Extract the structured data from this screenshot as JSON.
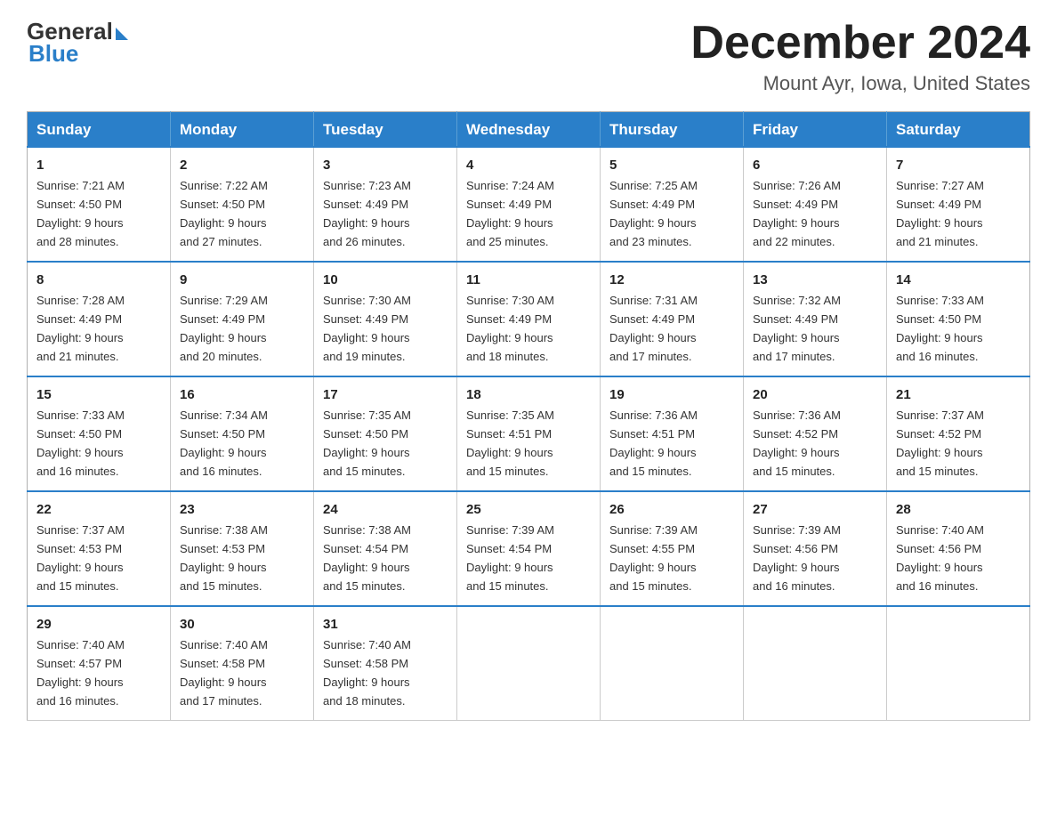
{
  "header": {
    "logo": {
      "general": "General",
      "blue": "Blue"
    },
    "title": "December 2024",
    "subtitle": "Mount Ayr, Iowa, United States"
  },
  "calendar": {
    "headers": [
      "Sunday",
      "Monday",
      "Tuesday",
      "Wednesday",
      "Thursday",
      "Friday",
      "Saturday"
    ],
    "weeks": [
      [
        {
          "day": "1",
          "info": "Sunrise: 7:21 AM\nSunset: 4:50 PM\nDaylight: 9 hours\nand 28 minutes."
        },
        {
          "day": "2",
          "info": "Sunrise: 7:22 AM\nSunset: 4:50 PM\nDaylight: 9 hours\nand 27 minutes."
        },
        {
          "day": "3",
          "info": "Sunrise: 7:23 AM\nSunset: 4:49 PM\nDaylight: 9 hours\nand 26 minutes."
        },
        {
          "day": "4",
          "info": "Sunrise: 7:24 AM\nSunset: 4:49 PM\nDaylight: 9 hours\nand 25 minutes."
        },
        {
          "day": "5",
          "info": "Sunrise: 7:25 AM\nSunset: 4:49 PM\nDaylight: 9 hours\nand 23 minutes."
        },
        {
          "day": "6",
          "info": "Sunrise: 7:26 AM\nSunset: 4:49 PM\nDaylight: 9 hours\nand 22 minutes."
        },
        {
          "day": "7",
          "info": "Sunrise: 7:27 AM\nSunset: 4:49 PM\nDaylight: 9 hours\nand 21 minutes."
        }
      ],
      [
        {
          "day": "8",
          "info": "Sunrise: 7:28 AM\nSunset: 4:49 PM\nDaylight: 9 hours\nand 21 minutes."
        },
        {
          "day": "9",
          "info": "Sunrise: 7:29 AM\nSunset: 4:49 PM\nDaylight: 9 hours\nand 20 minutes."
        },
        {
          "day": "10",
          "info": "Sunrise: 7:30 AM\nSunset: 4:49 PM\nDaylight: 9 hours\nand 19 minutes."
        },
        {
          "day": "11",
          "info": "Sunrise: 7:30 AM\nSunset: 4:49 PM\nDaylight: 9 hours\nand 18 minutes."
        },
        {
          "day": "12",
          "info": "Sunrise: 7:31 AM\nSunset: 4:49 PM\nDaylight: 9 hours\nand 17 minutes."
        },
        {
          "day": "13",
          "info": "Sunrise: 7:32 AM\nSunset: 4:49 PM\nDaylight: 9 hours\nand 17 minutes."
        },
        {
          "day": "14",
          "info": "Sunrise: 7:33 AM\nSunset: 4:50 PM\nDaylight: 9 hours\nand 16 minutes."
        }
      ],
      [
        {
          "day": "15",
          "info": "Sunrise: 7:33 AM\nSunset: 4:50 PM\nDaylight: 9 hours\nand 16 minutes."
        },
        {
          "day": "16",
          "info": "Sunrise: 7:34 AM\nSunset: 4:50 PM\nDaylight: 9 hours\nand 16 minutes."
        },
        {
          "day": "17",
          "info": "Sunrise: 7:35 AM\nSunset: 4:50 PM\nDaylight: 9 hours\nand 15 minutes."
        },
        {
          "day": "18",
          "info": "Sunrise: 7:35 AM\nSunset: 4:51 PM\nDaylight: 9 hours\nand 15 minutes."
        },
        {
          "day": "19",
          "info": "Sunrise: 7:36 AM\nSunset: 4:51 PM\nDaylight: 9 hours\nand 15 minutes."
        },
        {
          "day": "20",
          "info": "Sunrise: 7:36 AM\nSunset: 4:52 PM\nDaylight: 9 hours\nand 15 minutes."
        },
        {
          "day": "21",
          "info": "Sunrise: 7:37 AM\nSunset: 4:52 PM\nDaylight: 9 hours\nand 15 minutes."
        }
      ],
      [
        {
          "day": "22",
          "info": "Sunrise: 7:37 AM\nSunset: 4:53 PM\nDaylight: 9 hours\nand 15 minutes."
        },
        {
          "day": "23",
          "info": "Sunrise: 7:38 AM\nSunset: 4:53 PM\nDaylight: 9 hours\nand 15 minutes."
        },
        {
          "day": "24",
          "info": "Sunrise: 7:38 AM\nSunset: 4:54 PM\nDaylight: 9 hours\nand 15 minutes."
        },
        {
          "day": "25",
          "info": "Sunrise: 7:39 AM\nSunset: 4:54 PM\nDaylight: 9 hours\nand 15 minutes."
        },
        {
          "day": "26",
          "info": "Sunrise: 7:39 AM\nSunset: 4:55 PM\nDaylight: 9 hours\nand 15 minutes."
        },
        {
          "day": "27",
          "info": "Sunrise: 7:39 AM\nSunset: 4:56 PM\nDaylight: 9 hours\nand 16 minutes."
        },
        {
          "day": "28",
          "info": "Sunrise: 7:40 AM\nSunset: 4:56 PM\nDaylight: 9 hours\nand 16 minutes."
        }
      ],
      [
        {
          "day": "29",
          "info": "Sunrise: 7:40 AM\nSunset: 4:57 PM\nDaylight: 9 hours\nand 16 minutes."
        },
        {
          "day": "30",
          "info": "Sunrise: 7:40 AM\nSunset: 4:58 PM\nDaylight: 9 hours\nand 17 minutes."
        },
        {
          "day": "31",
          "info": "Sunrise: 7:40 AM\nSunset: 4:58 PM\nDaylight: 9 hours\nand 18 minutes."
        },
        {
          "day": "",
          "info": ""
        },
        {
          "day": "",
          "info": ""
        },
        {
          "day": "",
          "info": ""
        },
        {
          "day": "",
          "info": ""
        }
      ]
    ]
  }
}
